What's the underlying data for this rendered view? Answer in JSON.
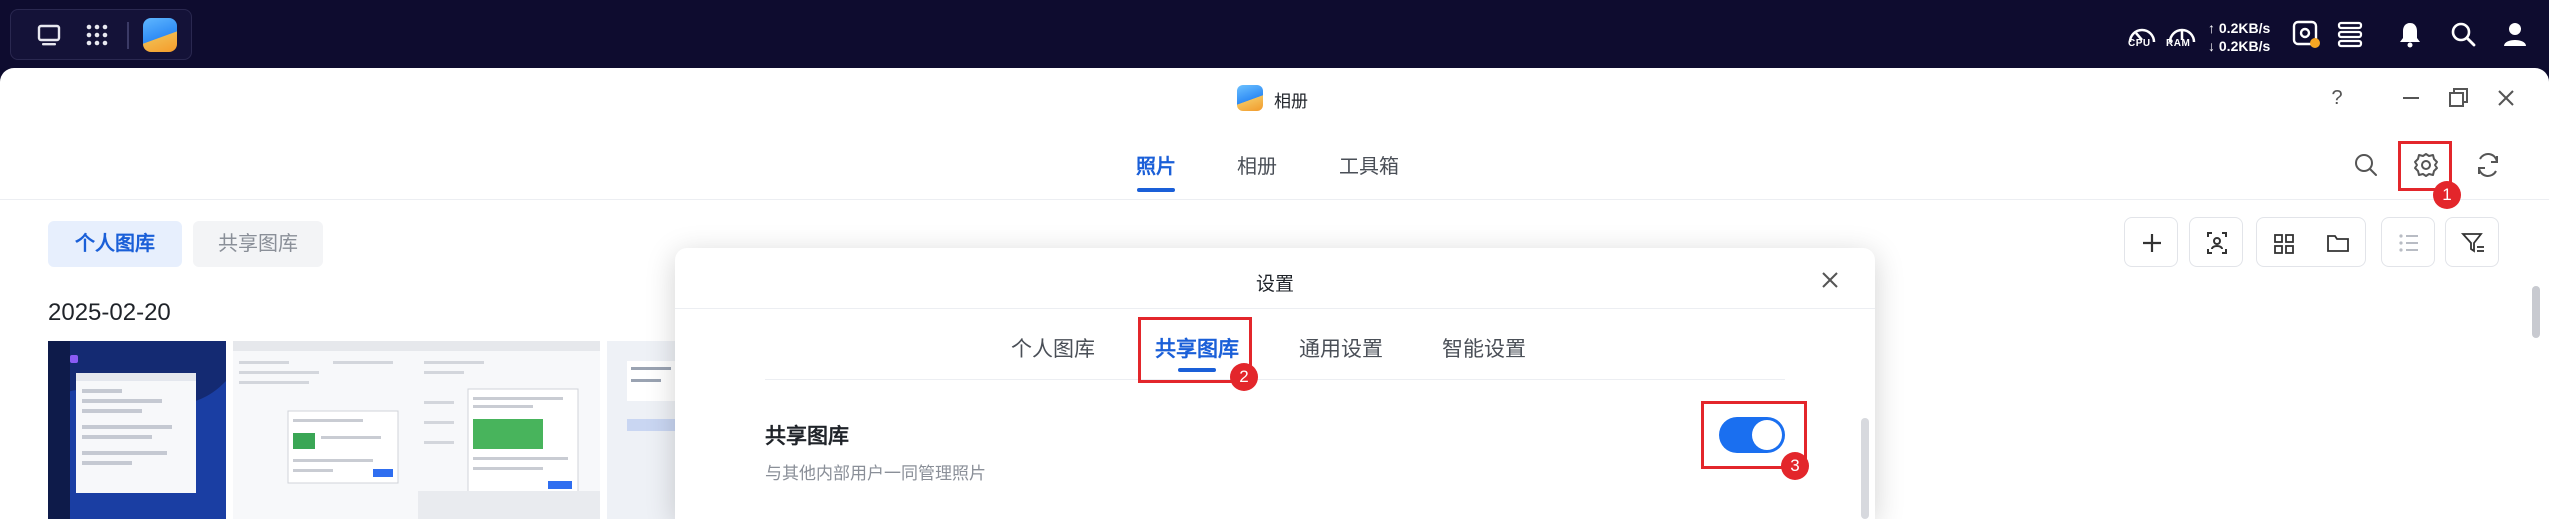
{
  "system_bar": {
    "cpu_label": "CPU",
    "ram_label": "RAM",
    "upload_speed": "↑ 0.2KB/s",
    "download_speed": "↓ 0.2KB/s"
  },
  "window": {
    "title": "相册",
    "help": "?",
    "main_tabs": [
      {
        "label": "照片",
        "active": true
      },
      {
        "label": "相册",
        "active": false
      },
      {
        "label": "工具箱",
        "active": false
      }
    ],
    "libraries": [
      {
        "label": "个人图库",
        "active": true
      },
      {
        "label": "共享图库",
        "active": false
      }
    ],
    "date_group": "2025-02-20"
  },
  "settings_dialog": {
    "title": "设置",
    "tabs": [
      {
        "label": "个人图库",
        "active": false
      },
      {
        "label": "共享图库",
        "active": true
      },
      {
        "label": "通用设置",
        "active": false
      },
      {
        "label": "智能设置",
        "active": false
      }
    ],
    "shared_library": {
      "title": "共享图库",
      "description": "与其他内部用户一同管理照片",
      "enabled": true
    }
  },
  "annotations": [
    "1",
    "2",
    "3"
  ],
  "colors": {
    "accent": "#1a5fd8",
    "toggle_on": "#1a6ff0",
    "highlight": "#e3262b",
    "system_bar": "#0e0c2f"
  }
}
